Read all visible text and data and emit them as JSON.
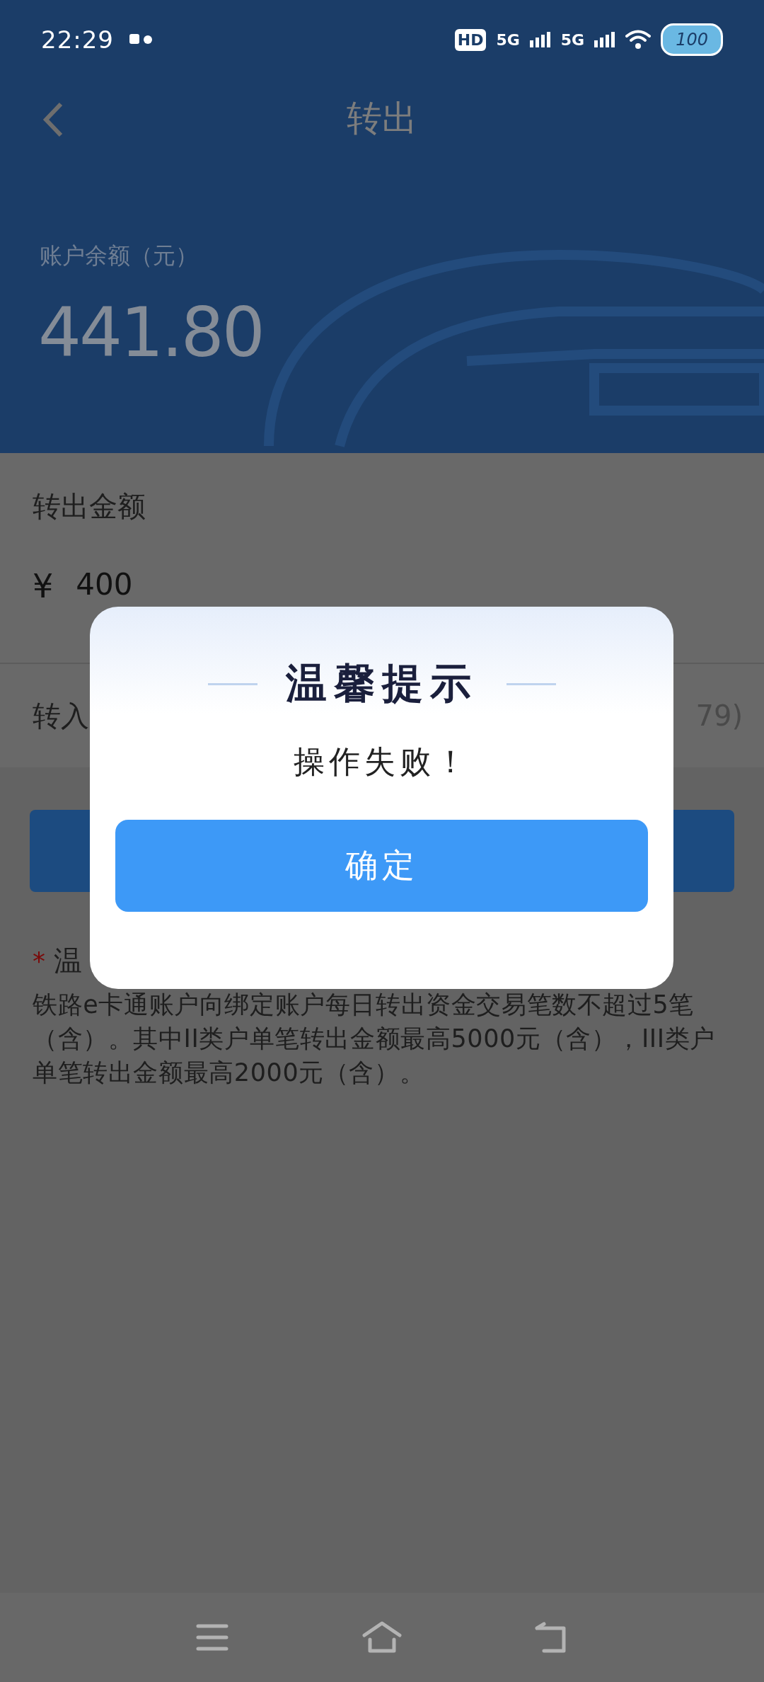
{
  "status_bar": {
    "time": "22:29",
    "network_labels": [
      "HD",
      "5G",
      "5G"
    ],
    "battery": "100"
  },
  "header": {
    "title": "转出",
    "balance_label": "账户余额（元）",
    "balance": "441.80"
  },
  "form": {
    "amount_label": "转出金额",
    "currency": "¥",
    "amount_value": "400",
    "target_label": "转入",
    "target_value": "79)"
  },
  "notice": {
    "marker": "*",
    "title": "温",
    "body": "铁路e卡通账户向绑定账户每日转出资金交易笔数不超过5笔（含）。其中II类户单笔转出金额最高5000元（含），III类户单笔转出金额最高2000元（含）。"
  },
  "dialog": {
    "title": "温馨提示",
    "message": "操作失败！",
    "button": "确定"
  },
  "nav_bar": {
    "buttons": [
      {
        "kind": "menu"
      },
      {
        "kind": "home"
      },
      {
        "kind": "back"
      }
    ]
  }
}
